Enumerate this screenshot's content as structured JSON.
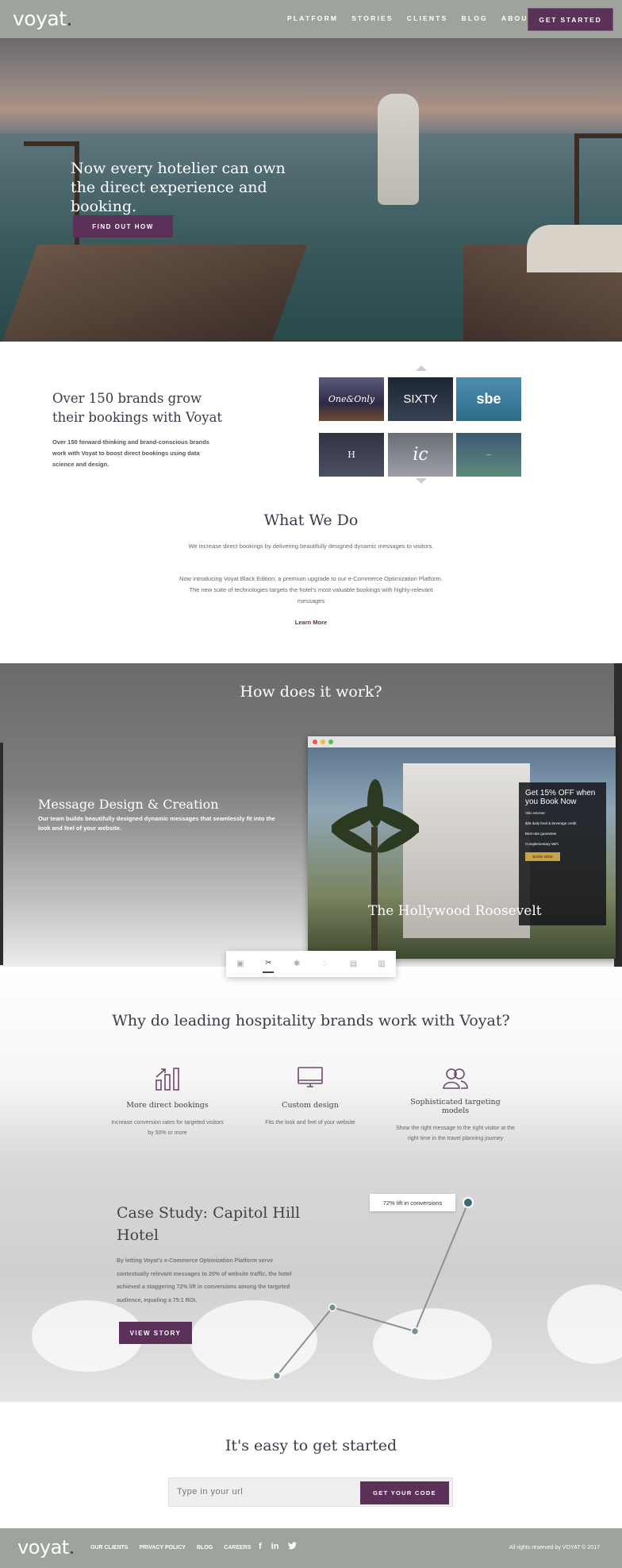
{
  "header": {
    "logo": "voyat",
    "nav": [
      "PLATFORM",
      "STORIES",
      "CLIENTS",
      "BLOG",
      "ABOUT"
    ],
    "cta": "GET STARTED"
  },
  "hero": {
    "title": "Now every hotelier can own the direct experience and booking.",
    "cta": "FIND OUT HOW"
  },
  "brands": {
    "title": "Over 150 brands grow their bookings with Voyat",
    "text": "Over 150 forward-thinking and brand-conscious brands work with Voyat to boost direct bookings using data science and design.",
    "tiles": [
      "One&Only",
      "SIXTY",
      "sbe",
      "H",
      "ic",
      "—"
    ]
  },
  "what_we_do": {
    "title": "What We Do",
    "p1": "We increase direct bookings by delivering beautifully designed dynamic messages to visitors.",
    "p2": "Now introducing Voyat Black Edition: a premium upgrade to our e-Commerce Optimization Platform. The new suite of technologies targets the hotel's most valuable bookings with highly-relevant messages",
    "link": "Learn More"
  },
  "how": {
    "title": "How does it work?",
    "subtitle": "Message Design & Creation",
    "text": "Our team builds beautifully designed dynamic messages that seamlessly fit into the look and feel of your website.",
    "popup_title": "Get 15% OFF when you Book Now",
    "popup_lines": [
      "Also receive:",
      "$25 daily food & beverage credit",
      "Best rate guarantee",
      "Complementary WiFi"
    ],
    "popup_button": "BOOK NOW",
    "hotel_name": "The Hollywood Roosevelt"
  },
  "why": {
    "title": "Why do leading hospitality brands work with Voyat?",
    "features": [
      {
        "title": "More direct bookings",
        "desc": "Increase conversion rates for targeted visitors by 50% or more"
      },
      {
        "title": "Custom design",
        "desc": "Fits the look and feel of your website"
      },
      {
        "title": "Sophisticated targeting models",
        "desc": "Show the right message to the right visitor at the right time in the travel planning journey"
      }
    ]
  },
  "case": {
    "title": "Case Study: Capitol Hill Hotel",
    "text": "By letting Voyat's e-Commerce Optimization Platform serve contextually relevant messages to 20% of website traffic, the hotel achieved a staggering 72% lift in conversions among the targeted audience, equaling a 75:1 ROI.",
    "cta": "VIEW STORY",
    "lift_label": "72% lift in conversions"
  },
  "get_started": {
    "title": "It's easy to get started",
    "placeholder": "Type in your url",
    "cta": "GET YOUR CODE"
  },
  "footer": {
    "logo": "voyat",
    "links": [
      "OUR CLIENTS",
      "PRIVACY POLICY",
      "BLOG",
      "CAREERS"
    ],
    "social": [
      "facebook-icon",
      "linkedin-icon",
      "twitter-icon"
    ],
    "copyright": "All rights reserved by VOYAT © 2017"
  }
}
